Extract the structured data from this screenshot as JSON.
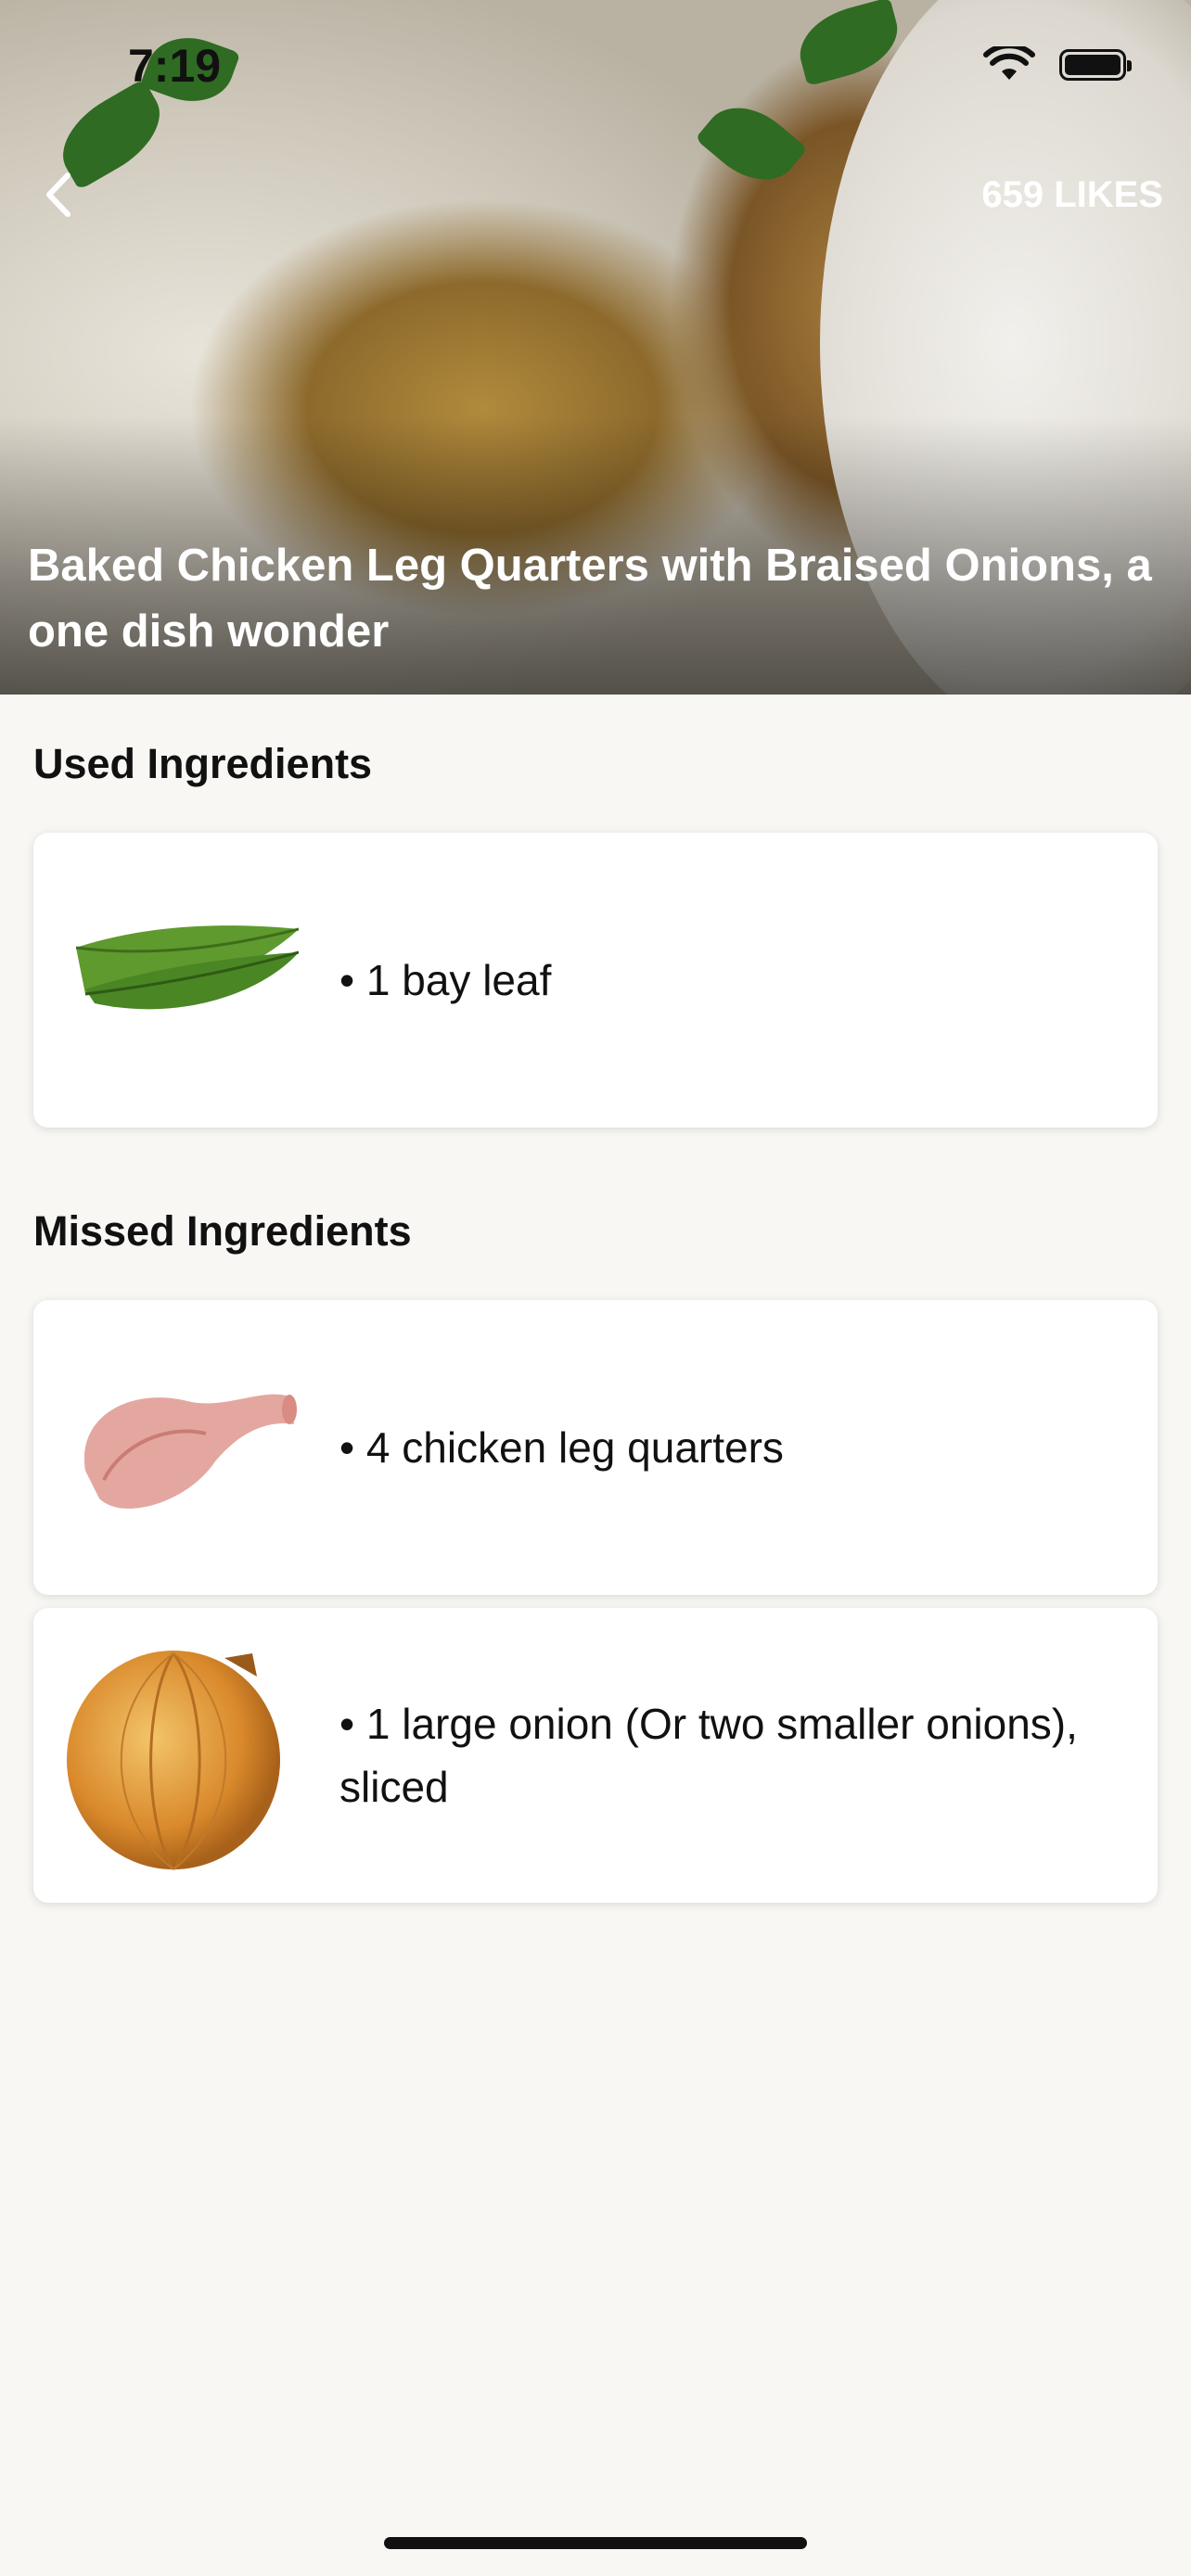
{
  "status_bar": {
    "time": "7:19"
  },
  "recipe": {
    "title": "Baked Chicken Leg Quarters with Braised Onions, a one dish wonder",
    "likes": "659 LIKES"
  },
  "sections": {
    "used_heading": "Used Ingredients",
    "missed_heading": "Missed Ingredients"
  },
  "used_ingredients": [
    {
      "text": "• 1 bay leaf",
      "icon": "bay-leaf-image"
    }
  ],
  "missed_ingredients": [
    {
      "text": "• 4 chicken leg quarters",
      "icon": "chicken-leg-image"
    },
    {
      "text": "• 1 large onion (Or two smaller onions), sliced",
      "icon": "onion-image"
    }
  ],
  "colors": {
    "background": "#f8f7f4",
    "card": "#ffffff",
    "text": "#111111"
  }
}
